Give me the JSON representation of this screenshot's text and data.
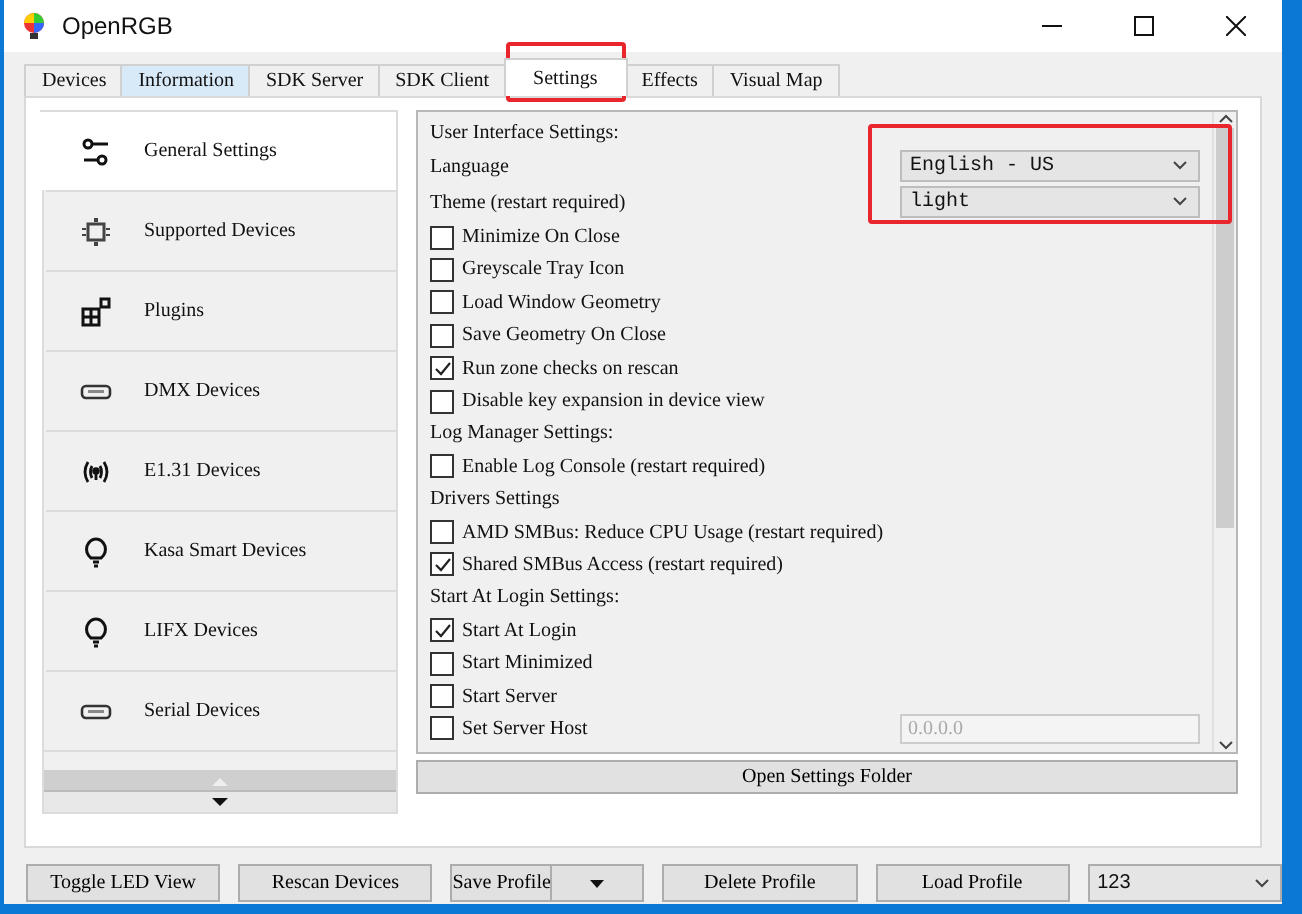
{
  "window": {
    "title": "OpenRGB"
  },
  "tabs": [
    {
      "label": "Devices",
      "selected": false,
      "hovered": false,
      "highlighted": false
    },
    {
      "label": "Information",
      "selected": false,
      "hovered": true,
      "highlighted": false
    },
    {
      "label": "SDK Server",
      "selected": false,
      "hovered": false,
      "highlighted": false
    },
    {
      "label": "SDK Client",
      "selected": false,
      "hovered": false,
      "highlighted": false
    },
    {
      "label": "Settings",
      "selected": true,
      "hovered": false,
      "highlighted": true
    },
    {
      "label": "Effects",
      "selected": false,
      "hovered": false,
      "highlighted": false
    },
    {
      "label": "Visual Map",
      "selected": false,
      "hovered": false,
      "highlighted": false
    }
  ],
  "sidebar": {
    "items": [
      {
        "label": "General Settings",
        "selected": true
      },
      {
        "label": "Supported Devices",
        "selected": false
      },
      {
        "label": "Plugins",
        "selected": false
      },
      {
        "label": "DMX Devices",
        "selected": false
      },
      {
        "label": "E1.31 Devices",
        "selected": false
      },
      {
        "label": "Kasa Smart Devices",
        "selected": false
      },
      {
        "label": "LIFX Devices",
        "selected": false
      },
      {
        "label": "Serial Devices",
        "selected": false
      }
    ]
  },
  "settings": {
    "highlight_selects": true,
    "rows": [
      {
        "kind": "header",
        "label": "User Interface Settings:"
      },
      {
        "kind": "select",
        "label": "Language",
        "value": "English - US"
      },
      {
        "kind": "select",
        "label": "Theme (restart required)",
        "value": "light"
      },
      {
        "kind": "checkbox",
        "label": "Minimize On Close",
        "checked": false
      },
      {
        "kind": "checkbox",
        "label": "Greyscale Tray Icon",
        "checked": false
      },
      {
        "kind": "checkbox",
        "label": "Load Window Geometry",
        "checked": false
      },
      {
        "kind": "checkbox",
        "label": "Save Geometry On Close",
        "checked": false
      },
      {
        "kind": "checkbox",
        "label": "Run zone checks on rescan",
        "checked": true
      },
      {
        "kind": "checkbox",
        "label": "Disable key expansion in device view",
        "checked": false
      },
      {
        "kind": "header",
        "label": "Log Manager Settings:"
      },
      {
        "kind": "checkbox",
        "label": "Enable Log Console (restart required)",
        "checked": false
      },
      {
        "kind": "header",
        "label": "Drivers Settings"
      },
      {
        "kind": "checkbox",
        "label": "AMD SMBus: Reduce CPU Usage (restart required)",
        "checked": false
      },
      {
        "kind": "checkbox",
        "label": "Shared SMBus Access (restart required)",
        "checked": true
      },
      {
        "kind": "header",
        "label": "Start At Login Settings:"
      },
      {
        "kind": "checkbox",
        "label": "Start At Login",
        "checked": true
      },
      {
        "kind": "checkbox",
        "label": "Start Minimized",
        "checked": false
      },
      {
        "kind": "checkbox",
        "label": "Start Server",
        "checked": false
      },
      {
        "kind": "checkbox_input",
        "label": "Set Server Host",
        "checked": false,
        "placeholder": "0.0.0.0"
      }
    ],
    "folder_button": "Open Settings Folder"
  },
  "footer": {
    "buttons": [
      {
        "label": "Toggle LED View",
        "kind": "button"
      },
      {
        "label": "Rescan Devices",
        "kind": "button"
      },
      {
        "label": "Save Profile",
        "kind": "split"
      },
      {
        "label": "Delete Profile",
        "kind": "button"
      },
      {
        "label": "Load Profile",
        "kind": "button"
      }
    ],
    "profile": "123"
  }
}
